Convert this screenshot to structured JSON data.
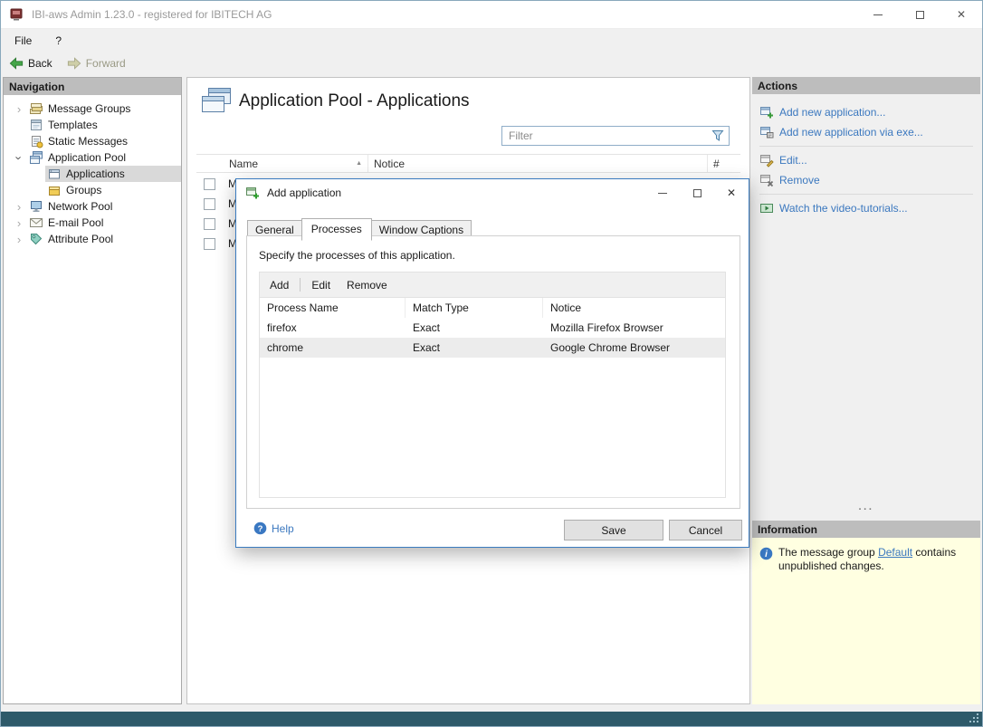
{
  "window": {
    "title": "IBI-aws Admin 1.23.0 - registered for IBITECH AG"
  },
  "menu": {
    "file": "File",
    "help": "?"
  },
  "toolbar": {
    "back": "Back",
    "forward": "Forward"
  },
  "navigation": {
    "header": "Navigation",
    "items": [
      {
        "label": "Message Groups",
        "icon": "message-groups-icon",
        "expanded": false
      },
      {
        "label": "Templates",
        "icon": "templates-icon"
      },
      {
        "label": "Static Messages",
        "icon": "static-messages-icon"
      },
      {
        "label": "Application Pool",
        "icon": "application-pool-icon",
        "expanded": true
      },
      {
        "label": "Applications",
        "icon": "applications-icon",
        "selected": true,
        "child": true
      },
      {
        "label": "Groups",
        "icon": "groups-icon",
        "child": true
      },
      {
        "label": "Network Pool",
        "icon": "network-pool-icon",
        "expanded": false
      },
      {
        "label": "E-mail Pool",
        "icon": "email-pool-icon",
        "expanded": false
      },
      {
        "label": "Attribute Pool",
        "icon": "attribute-pool-icon",
        "expanded": false
      }
    ]
  },
  "main": {
    "title": "Application Pool - Applications",
    "filter_placeholder": "Filter",
    "grid": {
      "columns": {
        "name": "Name",
        "notice": "Notice",
        "count": "#"
      },
      "rows": [
        {
          "name": "M"
        },
        {
          "name": "M"
        },
        {
          "name": "M"
        },
        {
          "name": "M"
        }
      ]
    }
  },
  "dialog": {
    "title": "Add application",
    "tabs": {
      "general": "General",
      "processes": "Processes",
      "captions": "Window Captions"
    },
    "active_tab": "Processes",
    "description": "Specify the processes of this application.",
    "toolbar": {
      "add": "Add",
      "edit": "Edit",
      "remove": "Remove"
    },
    "grid": {
      "columns": {
        "process": "Process Name",
        "match": "Match Type",
        "notice": "Notice"
      },
      "rows": [
        {
          "process": "firefox",
          "match": "Exact",
          "notice": "Mozilla Firefox Browser",
          "selected": false
        },
        {
          "process": "chrome",
          "match": "Exact",
          "notice": "Google Chrome Browser",
          "selected": true
        }
      ]
    },
    "help_label": "Help",
    "buttons": {
      "save": "Save",
      "cancel": "Cancel"
    }
  },
  "actions": {
    "header": "Actions",
    "items": [
      {
        "label": "Add new application...",
        "icon": "add-application-icon"
      },
      {
        "label": "Add new application via exe...",
        "icon": "add-application-via-exe-icon"
      },
      {
        "label": "Edit...",
        "icon": "edit-icon"
      },
      {
        "label": "Remove",
        "icon": "remove-icon"
      },
      {
        "label": "Watch the video-tutorials...",
        "icon": "video-tutorials-icon"
      }
    ],
    "splitter_dots": "···"
  },
  "information": {
    "header": "Information",
    "text_before": "The message group ",
    "link_text": "Default",
    "text_after": " contains unpublished changes."
  },
  "glyphs": {
    "close": "✕",
    "chevron": "›",
    "sort_asc": "▲"
  },
  "colors": {
    "link_blue": "#3b78bf",
    "panel_header": "#bdbdbd",
    "info_yellow": "#ffffe1",
    "dialog_border": "#3a7bbf",
    "statusbar": "#2e5a6a",
    "back_green": "#45a649"
  }
}
